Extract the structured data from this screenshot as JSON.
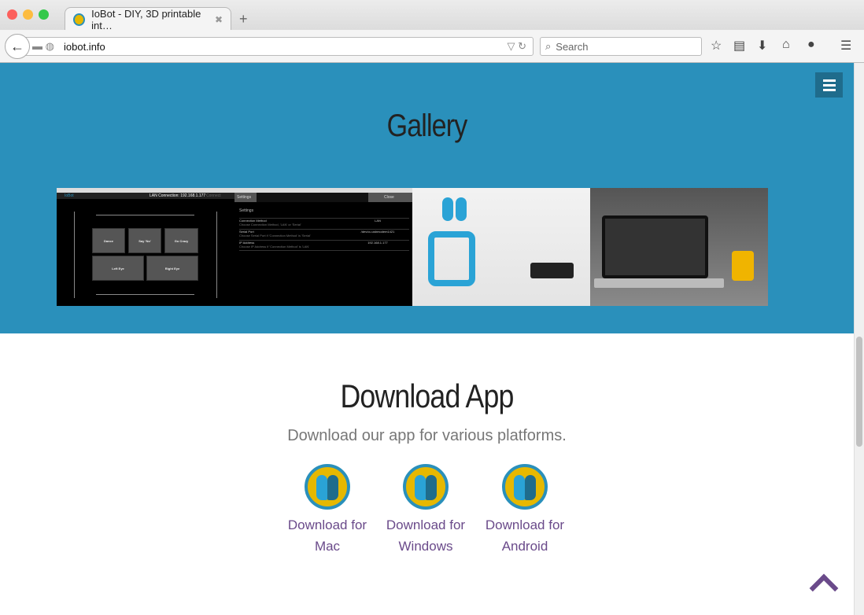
{
  "browser": {
    "tab_title": "IoBot - DIY, 3D printable int…",
    "url": "iobot.info",
    "search_placeholder": "Search",
    "icons": [
      "back-icon",
      "bookmark-star-icon",
      "reading-list-icon",
      "download-icon",
      "home-icon",
      "chat-icon",
      "hamburger-icon"
    ]
  },
  "gallery": {
    "title": "Gallery",
    "app1": {
      "title": "IoBot",
      "status": "LAN Connection: 192.168.1.177",
      "connect": "Connect",
      "buttons": [
        "Dance",
        "Say 'No'",
        "Go Crazy",
        "Left Eye",
        "Right Eye"
      ]
    },
    "app2": {
      "tab": "Settings",
      "close": "Close",
      "heading": "Settings",
      "rows": [
        {
          "label": "Connection Method",
          "hint": "Choose Connection Method, 'LAN' or 'Serial'",
          "value": "LAN"
        },
        {
          "label": "Serial Port",
          "hint": "Choose Serial Port if 'Connection Method' is 'Serial'",
          "value": "/dev/cu.usbmodem1421"
        },
        {
          "label": "IP Address",
          "hint": "Choose IP Address if 'Connection Method' is 'LAN'",
          "value": "192.168.1.177"
        }
      ]
    }
  },
  "download": {
    "title": "Download App",
    "subtitle": "Download our app for various platforms.",
    "links": [
      {
        "line1": "Download for",
        "line2": "Mac"
      },
      {
        "line1": "Download for",
        "line2": "Windows"
      },
      {
        "line1": "Download for",
        "line2": "Android"
      }
    ]
  },
  "colors": {
    "accent": "#2a90bb",
    "link": "#6a4a8a"
  }
}
